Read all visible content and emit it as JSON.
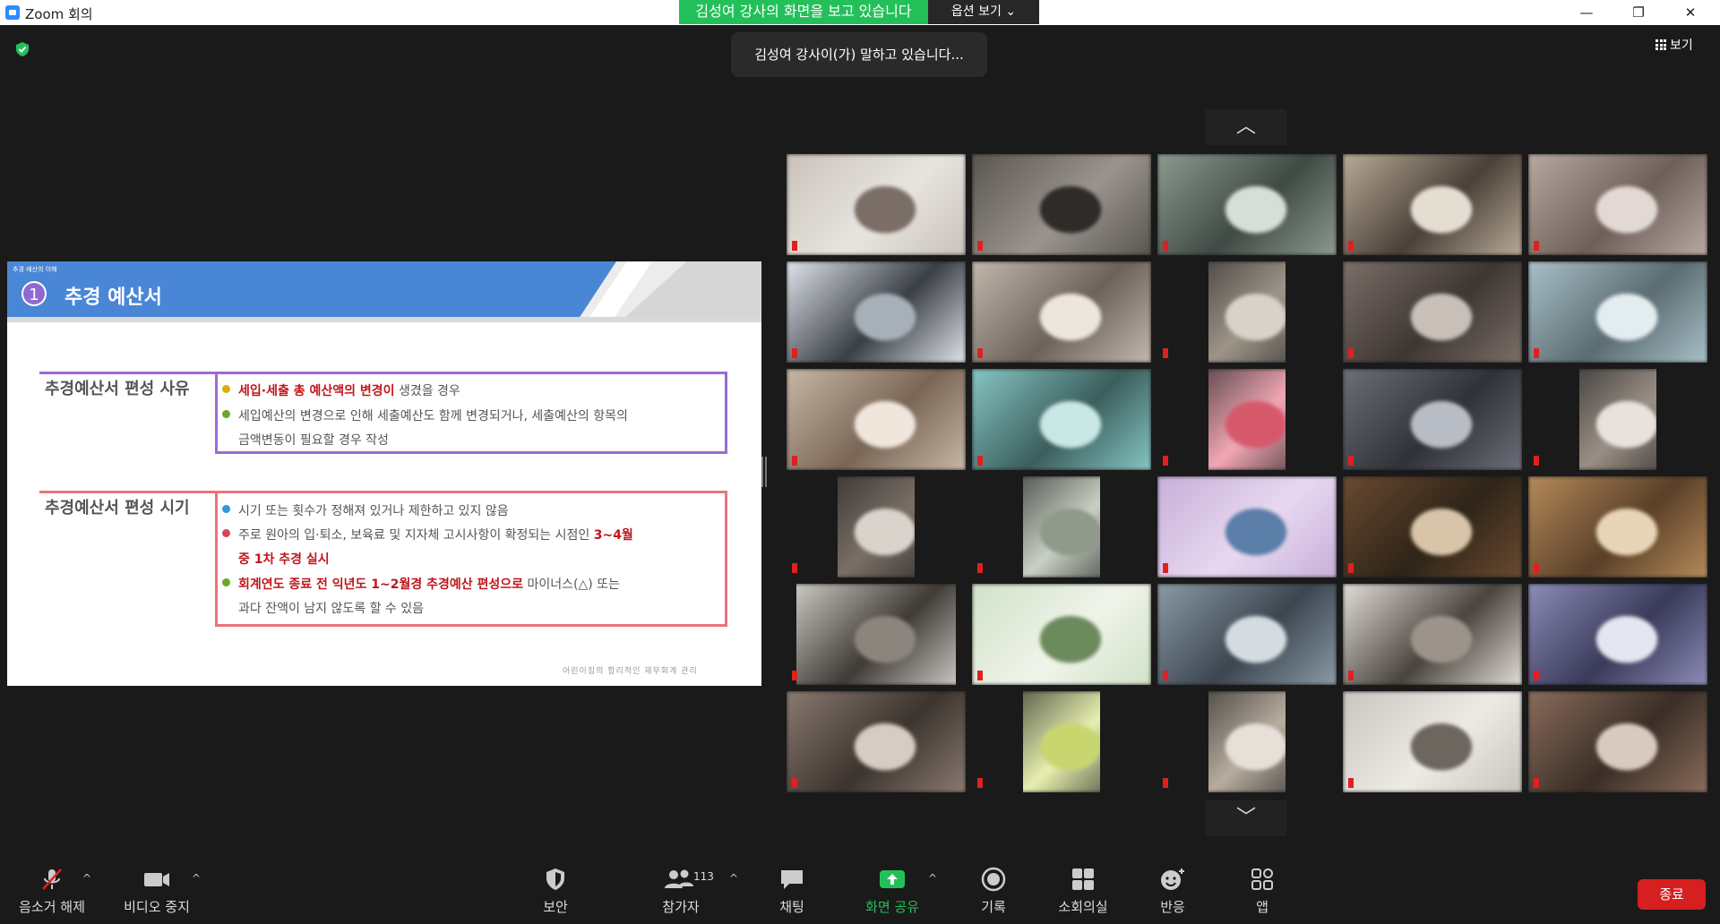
{
  "window": {
    "title": "Zoom 회의",
    "share_banner": "김성여 강사의 화면을 보고 있습니다",
    "view_options": "옵션 보기 ⌄",
    "minimize": "—",
    "restore": "❐",
    "close": "✕"
  },
  "overlay": {
    "speaking": "김성여 강사이(가) 말하고 있습니다...",
    "view_button": "보기"
  },
  "slide": {
    "small_label": "추경 예산의 이해",
    "number": "1",
    "title": "추경 예산서",
    "section1_label": "추경예산서 편성 사유",
    "s1_line1_red": "세입·세출 총 예산액의 변경이",
    "s1_line1_rest": " 생겼을 경우",
    "s1_line2": "세입예산의 변경으로 인해 세출예산도 함께 변경되거나, 세출예산의 항목의",
    "s1_line3": "금액변동이 필요할 경우 작성",
    "section2_label": "추경예산서 편성 시기",
    "s2_line1": "시기 또는 횟수가 정해져 있거나 제한하고 있지 않음",
    "s2_line2": "주로 원아의 입·퇴소, 보육료 및 지자체 고시사항이 확정되는 시점인 ",
    "s2_line2_red": "3~4월",
    "s2_line3_red": "중 1차 추경 실시",
    "s2_line4_red": "회계연도 종료 전 익년도 1~2월경 추경예산 편성으로",
    "s2_line4_rest": " 마이너스(△) 또는",
    "s2_line5": "과다 잔액이 남지 않도록 할 수 있음",
    "footer": "어린이집의 합리적인 재무회계 관리",
    "colors": {
      "blue": "#4a86d6",
      "purple": "#9b6bd6",
      "red_box": "#e8737a",
      "red_text": "#c0161b"
    }
  },
  "gallery": {
    "up_arrow": "︿",
    "down_arrow": "﹀"
  },
  "toolbar": {
    "mute": "음소거 해제",
    "video": "비디오 중지",
    "security": "보안",
    "participants": "참가자",
    "participants_count": "113",
    "chat": "채팅",
    "share": "화면 공유",
    "record": "기록",
    "breakout": "소회의실",
    "reactions": "반응",
    "apps": "앱",
    "end": "종료",
    "caret": "^",
    "colors": {
      "share_green": "#23c05a",
      "end_red": "#d61f1f"
    }
  }
}
